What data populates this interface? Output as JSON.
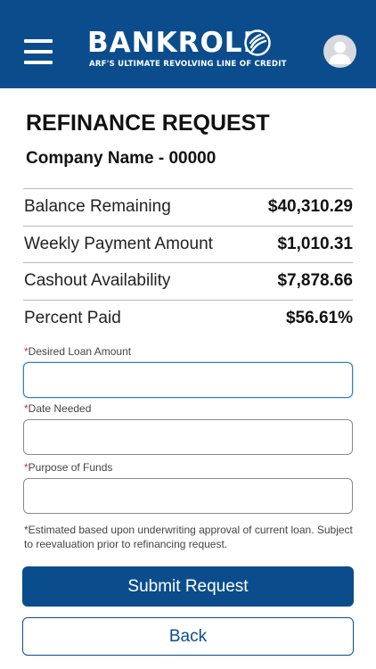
{
  "header": {
    "brand_name": "BANKROLL",
    "brand_tagline": "ARF'S ULTIMATE REVOLVING LINE OF CREDIT",
    "menu_icon": "hamburger-menu-icon",
    "profile_icon": "user-avatar-icon",
    "background_color": "#0b4d8c"
  },
  "page": {
    "title": "REFINANCE REQUEST",
    "company": "Company Name - 00000"
  },
  "stats": [
    {
      "label": "Balance Remaining",
      "value": "$40,310.29"
    },
    {
      "label": "Weekly Payment Amount",
      "value": "$1,010.31"
    },
    {
      "label": "Cashout Availability",
      "value": "$7,878.66"
    },
    {
      "label": "Percent Paid",
      "value": "$56.61%"
    }
  ],
  "form": {
    "required_marker": "*",
    "desired_loan_amount": {
      "label": "Desired Loan Amount",
      "value": ""
    },
    "date_needed": {
      "label": "Date Needed",
      "value": ""
    },
    "purpose_of_funds": {
      "label": "Purpose of Funds",
      "value": ""
    }
  },
  "note": "*Estimated based upon underwriting approval of current loan. Subject to reevaluation prior to refinancing request.",
  "buttons": {
    "submit": "Submit Request",
    "back": "Back"
  },
  "colors": {
    "primary": "#0b4d8c",
    "required": "#d0312d",
    "focus_border": "#2f7fc1"
  }
}
